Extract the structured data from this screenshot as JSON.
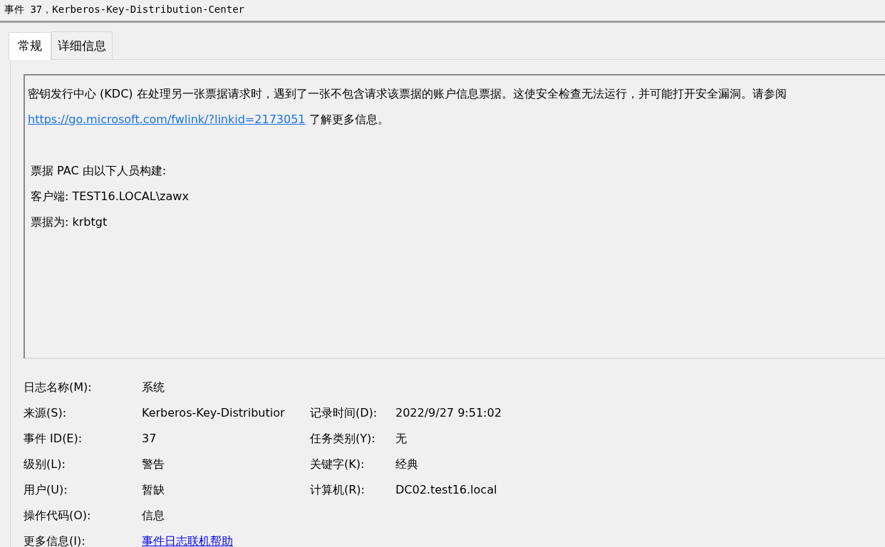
{
  "window": {
    "title": "事件 37，Kerberos-Key-Distribution-Center"
  },
  "tabs": [
    {
      "label": "常规",
      "selected": true
    },
    {
      "label": "详细信息",
      "selected": false
    }
  ],
  "description": {
    "paragraph": {
      "text": "密钥发行中心 (KDC) 在处理另一张票据请求时，遇到了一张不包含请求该票据的账户信息票据。这使安全检查无法运行，并可能打开安全漏洞。请参阅",
      "link": "https://go.microsoft.com/fwlink/?linkid=2173051",
      "after": "了解更多信息。"
    },
    "lines": [
      "票据 PAC 由以下人员构建:",
      "客户端: TEST16.LOCAL\\zawx",
      "票据为: krbtgt"
    ]
  },
  "fields": [
    {
      "cells": [
        {
          "label": "日志名称(M):",
          "value": "系统",
          "kind": "text"
        }
      ]
    },
    {
      "cells": [
        {
          "label": "来源(S):",
          "value": "Kerberos-Key-Distributior",
          "kind": "text"
        },
        {
          "label": "记录时间(D):",
          "value": "2022/9/27 9:51:02",
          "kind": "text"
        }
      ]
    },
    {
      "cells": [
        {
          "label": "事件 ID(E):",
          "value": "37",
          "kind": "text"
        },
        {
          "label": "任务类别(Y):",
          "value": "无",
          "kind": "text"
        }
      ]
    },
    {
      "cells": [
        {
          "label": "级别(L):",
          "value": "警告",
          "kind": "text"
        },
        {
          "label": "关键字(K):",
          "value": "经典",
          "kind": "text"
        }
      ]
    },
    {
      "cells": [
        {
          "label": "用户(U):",
          "value": "暂缺",
          "kind": "text"
        },
        {
          "label": "计算机(R):",
          "value": "DC02.test16.local",
          "kind": "text"
        }
      ]
    },
    {
      "cells": [
        {
          "label": "操作代码(O):",
          "value": "信息",
          "kind": "text"
        }
      ]
    },
    {
      "cells": [
        {
          "label": "更多信息(I):",
          "value": "事件日志联机帮助",
          "kind": "link"
        }
      ]
    }
  ]
}
